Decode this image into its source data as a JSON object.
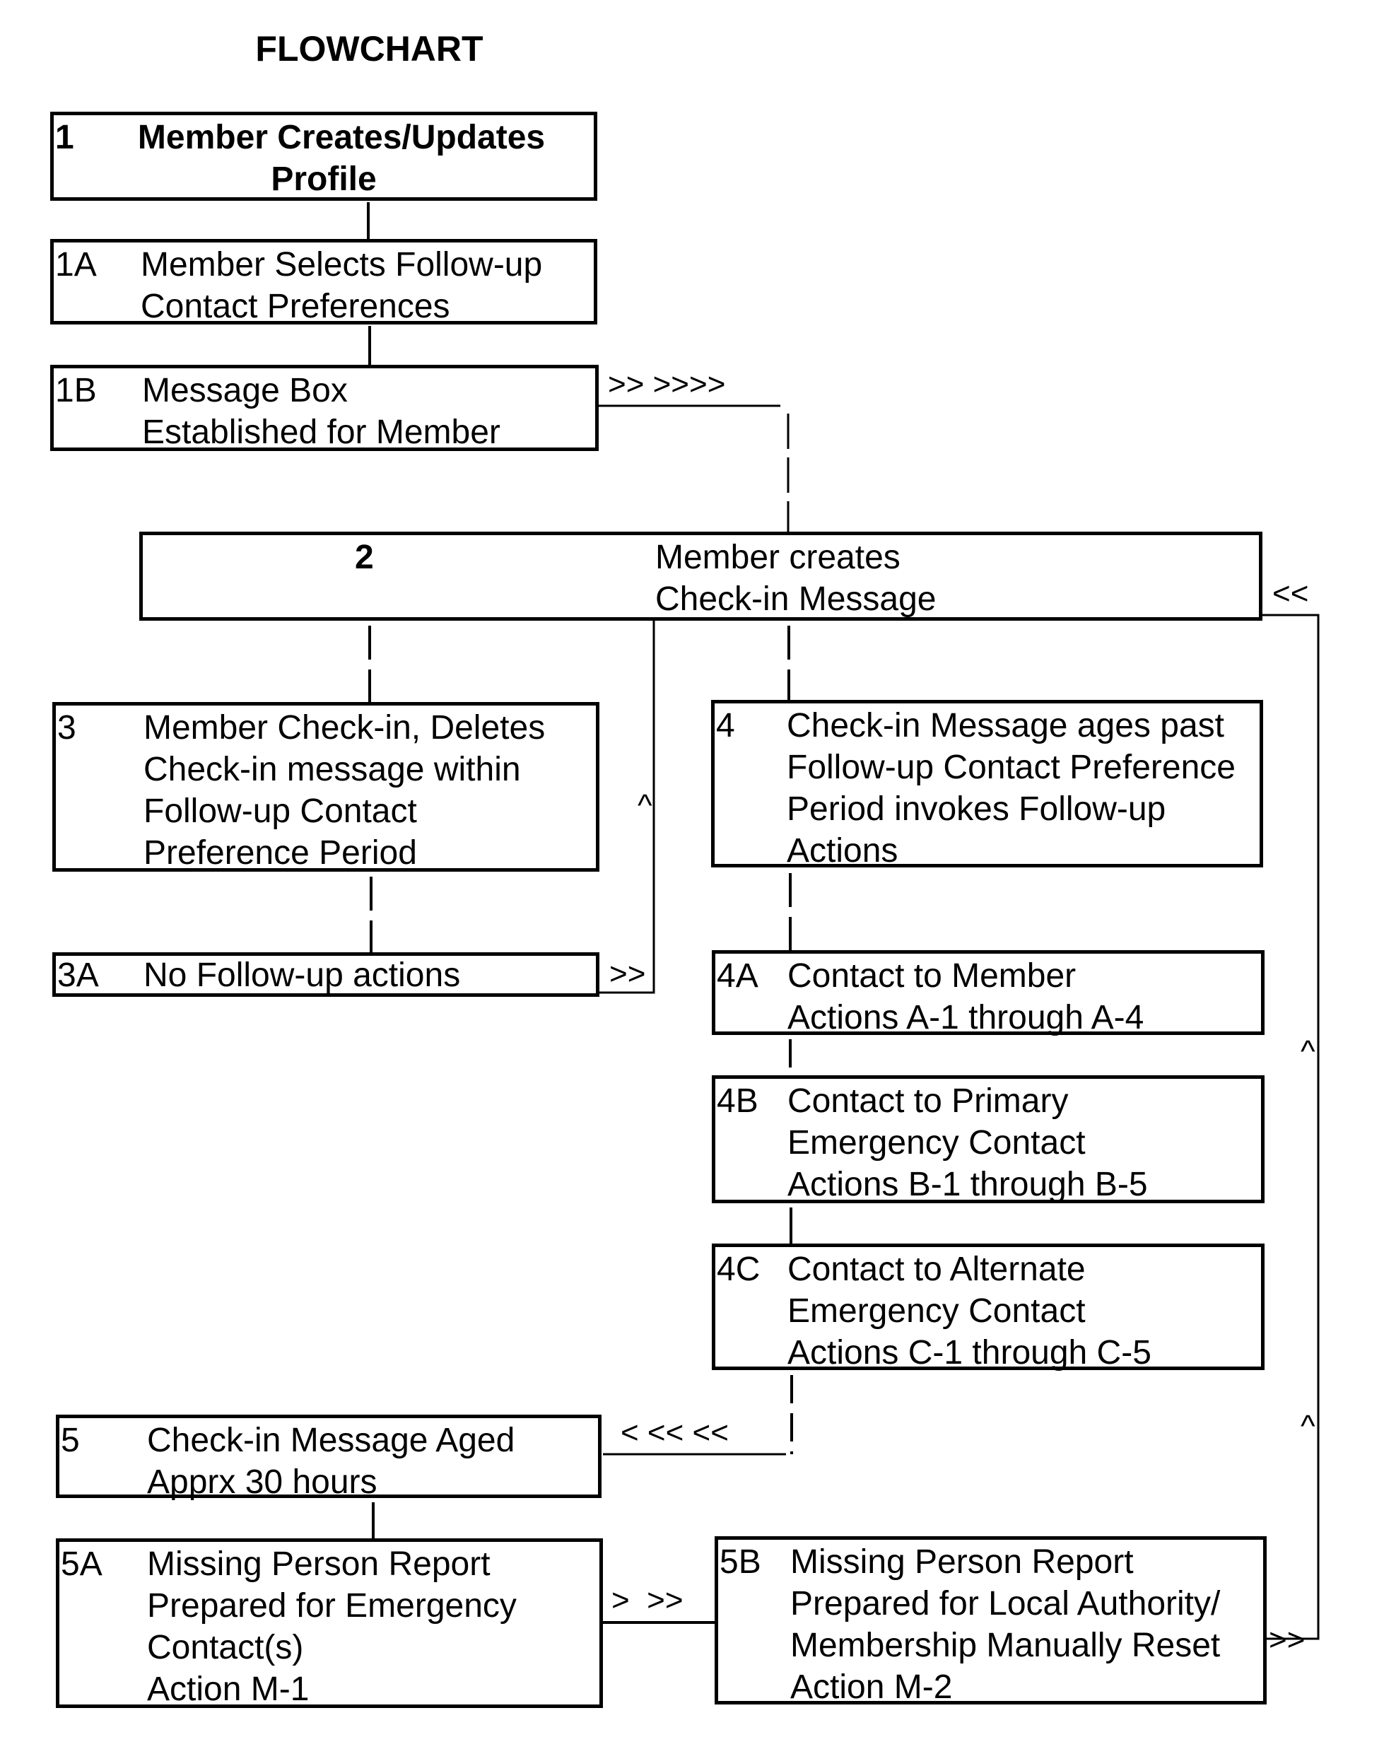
{
  "title": "FLOWCHART",
  "boxes": {
    "b1": {
      "id": "1",
      "lines": [
        "Member Creates/Updates",
        "Profile"
      ]
    },
    "b1a": {
      "id": "1A",
      "lines": [
        "Member Selects Follow-up",
        "Contact Preferences"
      ]
    },
    "b1b": {
      "id": "1B",
      "lines": [
        "Message Box",
        "Established for Member"
      ]
    },
    "b2": {
      "id": "2",
      "lines": [
        "Member creates",
        "Check-in Message"
      ]
    },
    "b3": {
      "id": "3",
      "lines": [
        "Member Check-in, Deletes",
        "Check-in message within",
        "Follow-up Contact",
        "Preference Period"
      ]
    },
    "b3a": {
      "id": "3A",
      "lines": [
        "No Follow-up actions"
      ]
    },
    "b4": {
      "id": "4",
      "lines": [
        "Check-in Message ages past",
        "Follow-up Contact Preference",
        "Period invokes Follow-up",
        "Actions"
      ]
    },
    "b4a": {
      "id": "4A",
      "lines": [
        "Contact to Member",
        "Actions A-1 through A-4"
      ]
    },
    "b4b": {
      "id": "4B",
      "lines": [
        "Contact to Primary",
        "Emergency Contact",
        "Actions B-1 through B-5"
      ]
    },
    "b4c": {
      "id": "4C",
      "lines": [
        "Contact to Alternate",
        "Emergency Contact",
        "Actions C-1 through C-5"
      ]
    },
    "b5": {
      "id": "5",
      "lines": [
        "Check-in Message Aged",
        "Apprx 30 hours"
      ]
    },
    "b5a": {
      "id": "5A",
      "lines": [
        "Missing Person Report",
        "Prepared for Emergency",
        "Contact(s)",
        "Action M-1"
      ]
    },
    "b5b": {
      "id": "5B",
      "lines": [
        "Missing Person Report",
        "Prepared for Local Authority/",
        "Membership Manually Reset",
        "Action M-2"
      ]
    }
  },
  "markers": {
    "m1b_to_2": ">> >>>>",
    "m_into_2": "<<",
    "m3_up": "^",
    "m3a_right": ">>",
    "m_right_up1": "^",
    "m_right_up2": "^",
    "m4c_to_5": "< << <<",
    "m5a_to_5b": ">  >>",
    "m5b_right": ">>"
  }
}
